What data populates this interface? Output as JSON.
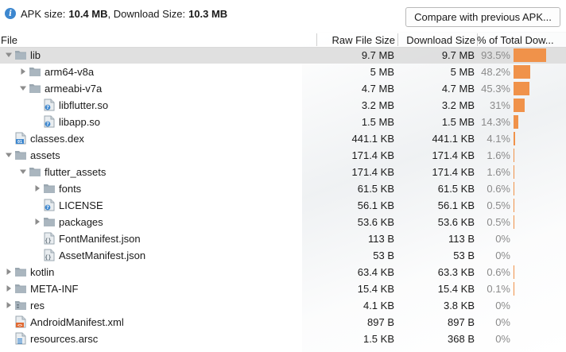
{
  "summary": {
    "apk_label": "APK size:",
    "apk_value": "10.4 MB",
    "download_label": ", Download Size:",
    "download_value": "10.3 MB"
  },
  "compare_button": "Compare with previous APK...",
  "columns": {
    "file": "File",
    "raw": "Raw File Size",
    "download": "Download Size",
    "percent": "% of Total Dow..."
  },
  "colors": {
    "bar": "#f0924a",
    "folder": "#9aa7b0",
    "info": "#3d87cf"
  },
  "rows": [
    {
      "name": "lib",
      "raw": "9.7 MB",
      "dl": "9.7 MB",
      "pct": "93.5%",
      "pct_value": 93.5,
      "depth": 0,
      "expander": "expanded",
      "icon": "folder-icon",
      "selected": true
    },
    {
      "name": "arm64-v8a",
      "raw": "5 MB",
      "dl": "5 MB",
      "pct": "48.2%",
      "pct_value": 48.2,
      "depth": 1,
      "expander": "collapsed",
      "icon": "folder-icon"
    },
    {
      "name": "armeabi-v7a",
      "raw": "4.7 MB",
      "dl": "4.7 MB",
      "pct": "45.3%",
      "pct_value": 45.3,
      "depth": 1,
      "expander": "expanded",
      "icon": "folder-icon"
    },
    {
      "name": "libflutter.so",
      "raw": "3.2 MB",
      "dl": "3.2 MB",
      "pct": "31%",
      "pct_value": 31,
      "depth": 2,
      "expander": "none",
      "icon": "unknown-file-icon"
    },
    {
      "name": "libapp.so",
      "raw": "1.5 MB",
      "dl": "1.5 MB",
      "pct": "14.3%",
      "pct_value": 14.3,
      "depth": 2,
      "expander": "none",
      "icon": "unknown-file-icon"
    },
    {
      "name": "classes.dex",
      "raw": "441.1 KB",
      "dl": "441.1 KB",
      "pct": "4.1%",
      "pct_value": 4.1,
      "depth": 0,
      "expander": "none",
      "icon": "dex-file-icon"
    },
    {
      "name": "assets",
      "raw": "171.4 KB",
      "dl": "171.4 KB",
      "pct": "1.6%",
      "pct_value": 1.6,
      "depth": 0,
      "expander": "expanded",
      "icon": "folder-icon"
    },
    {
      "name": "flutter_assets",
      "raw": "171.4 KB",
      "dl": "171.4 KB",
      "pct": "1.6%",
      "pct_value": 1.6,
      "depth": 1,
      "expander": "expanded",
      "icon": "folder-icon"
    },
    {
      "name": "fonts",
      "raw": "61.5 KB",
      "dl": "61.5 KB",
      "pct": "0.6%",
      "pct_value": 0.6,
      "depth": 2,
      "expander": "collapsed",
      "icon": "folder-icon"
    },
    {
      "name": "LICENSE",
      "raw": "56.1 KB",
      "dl": "56.1 KB",
      "pct": "0.5%",
      "pct_value": 0.5,
      "depth": 2,
      "expander": "none",
      "icon": "unknown-file-icon"
    },
    {
      "name": "packages",
      "raw": "53.6 KB",
      "dl": "53.6 KB",
      "pct": "0.5%",
      "pct_value": 0.5,
      "depth": 2,
      "expander": "collapsed",
      "icon": "folder-icon"
    },
    {
      "name": "FontManifest.json",
      "raw": "113 B",
      "dl": "113 B",
      "pct": "0%",
      "pct_value": 0,
      "depth": 2,
      "expander": "none",
      "icon": "json-file-icon"
    },
    {
      "name": "AssetManifest.json",
      "raw": "53 B",
      "dl": "53 B",
      "pct": "0%",
      "pct_value": 0,
      "depth": 2,
      "expander": "none",
      "icon": "json-file-icon"
    },
    {
      "name": "kotlin",
      "raw": "63.4 KB",
      "dl": "63.3 KB",
      "pct": "0.6%",
      "pct_value": 0.6,
      "depth": 0,
      "expander": "collapsed",
      "icon": "folder-icon"
    },
    {
      "name": "META-INF",
      "raw": "15.4 KB",
      "dl": "15.4 KB",
      "pct": "0.1%",
      "pct_value": 0.1,
      "depth": 0,
      "expander": "collapsed",
      "icon": "folder-icon"
    },
    {
      "name": "res",
      "raw": "4.1 KB",
      "dl": "3.8 KB",
      "pct": "0%",
      "pct_value": 0,
      "depth": 0,
      "expander": "collapsed",
      "icon": "resource-folder-icon"
    },
    {
      "name": "AndroidManifest.xml",
      "raw": "897 B",
      "dl": "897 B",
      "pct": "0%",
      "pct_value": 0,
      "depth": 0,
      "expander": "none",
      "icon": "xml-file-icon"
    },
    {
      "name": "resources.arsc",
      "raw": "1.5 KB",
      "dl": "368 B",
      "pct": "0%",
      "pct_value": 0,
      "depth": 0,
      "expander": "none",
      "icon": "arsc-file-icon"
    }
  ]
}
